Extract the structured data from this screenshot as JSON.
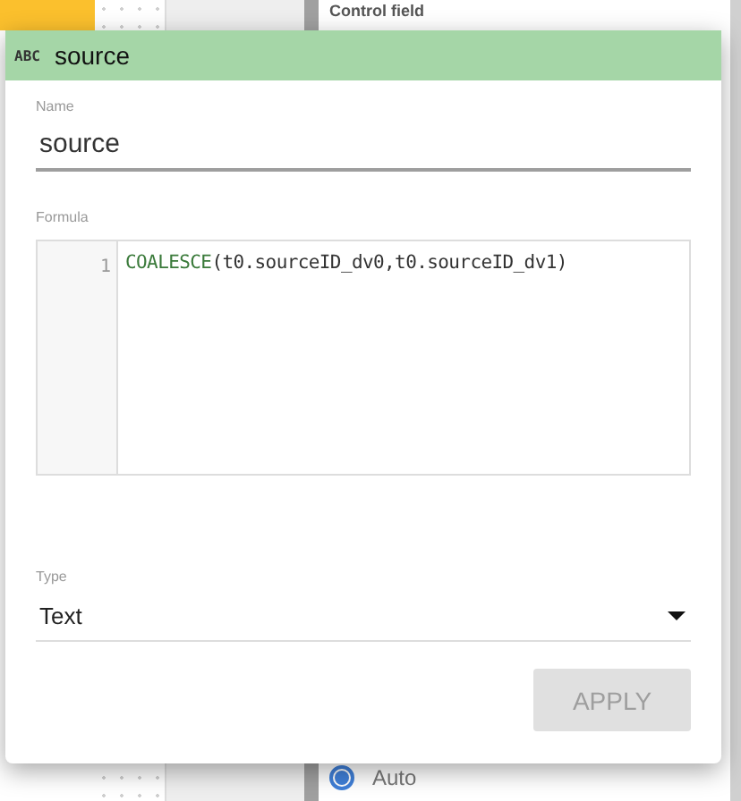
{
  "background": {
    "panel_heading": "Control field",
    "radio": {
      "label": "Auto",
      "selected": true
    }
  },
  "dialog": {
    "type_icon": "ABC",
    "title": "source",
    "name_field": {
      "label": "Name",
      "value": "source"
    },
    "formula": {
      "label": "Formula",
      "lines": [
        {
          "number": "1",
          "tokens": [
            {
              "text": "COALESCE",
              "kind": "function"
            },
            {
              "text": "(t0.sourceID_dv0,t0.sourceID_dv1)",
              "kind": "plain"
            }
          ]
        }
      ]
    },
    "type_field": {
      "label": "Type",
      "value": "Text"
    },
    "apply_button": {
      "label": "APPLY",
      "disabled": true
    }
  }
}
